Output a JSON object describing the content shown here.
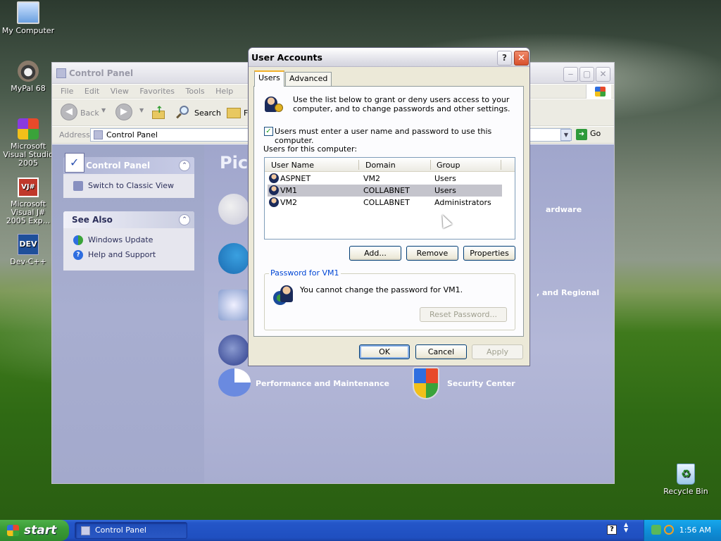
{
  "desktop": {
    "icons": [
      {
        "label": "My Computer"
      },
      {
        "label": "MyPal 68"
      },
      {
        "label": "Microsoft Visual Studio 2005"
      },
      {
        "label": "Microsoft Visual J# 2005 Exp..."
      },
      {
        "label": "Dev-C++"
      },
      {
        "label": "Recycle Bin"
      }
    ]
  },
  "control_panel": {
    "title": "Control Panel",
    "menu": [
      "File",
      "Edit",
      "View",
      "Favorites",
      "Tools",
      "Help"
    ],
    "toolbar": {
      "back": "Back",
      "search": "Search",
      "folders": "F"
    },
    "address": {
      "label": "Address",
      "value": "Control Panel",
      "go": "Go"
    },
    "left_panel": {
      "header": "Control Panel",
      "switch_view": "Switch to Classic View",
      "see_also": "See Also",
      "windows_update": "Windows Update",
      "help_support": "Help and Support"
    },
    "main": {
      "heading": "Pic",
      "categories": {
        "hardware": "ardware",
        "regional": ", and Regional",
        "performance": "Performance and Maintenance",
        "security": "Security Center"
      }
    }
  },
  "dialog": {
    "title": "User Accounts",
    "help": "?",
    "close": "✕",
    "tabs": [
      "Users",
      "Advanced"
    ],
    "intro_line1": "Use the list below to grant or deny users access to your",
    "intro_line2": "computer, and to change passwords and other settings.",
    "checkbox_label": "Users must enter a user name and password to use this computer.",
    "checkbox_checked": true,
    "list_label": "Users for this computer:",
    "columns": [
      "User Name",
      "Domain",
      "Group"
    ],
    "users": [
      {
        "name": "ASPNET",
        "domain": "VM2",
        "group": "Users"
      },
      {
        "name": "VM1",
        "domain": "COLLABNET",
        "group": "Users"
      },
      {
        "name": "VM2",
        "domain": "COLLABNET",
        "group": "Administrators"
      }
    ],
    "selected_user_index": 1,
    "buttons": {
      "add": "Add...",
      "remove": "Remove",
      "properties": "Properties"
    },
    "password_group": {
      "label": "Password for VM1",
      "message": "You cannot change the password for VM1.",
      "reset": "Reset Password..."
    },
    "footer": {
      "ok": "OK",
      "cancel": "Cancel",
      "apply": "Apply"
    }
  },
  "taskbar": {
    "start": "start",
    "task": "Control Panel",
    "clock": "1:56 AM"
  }
}
